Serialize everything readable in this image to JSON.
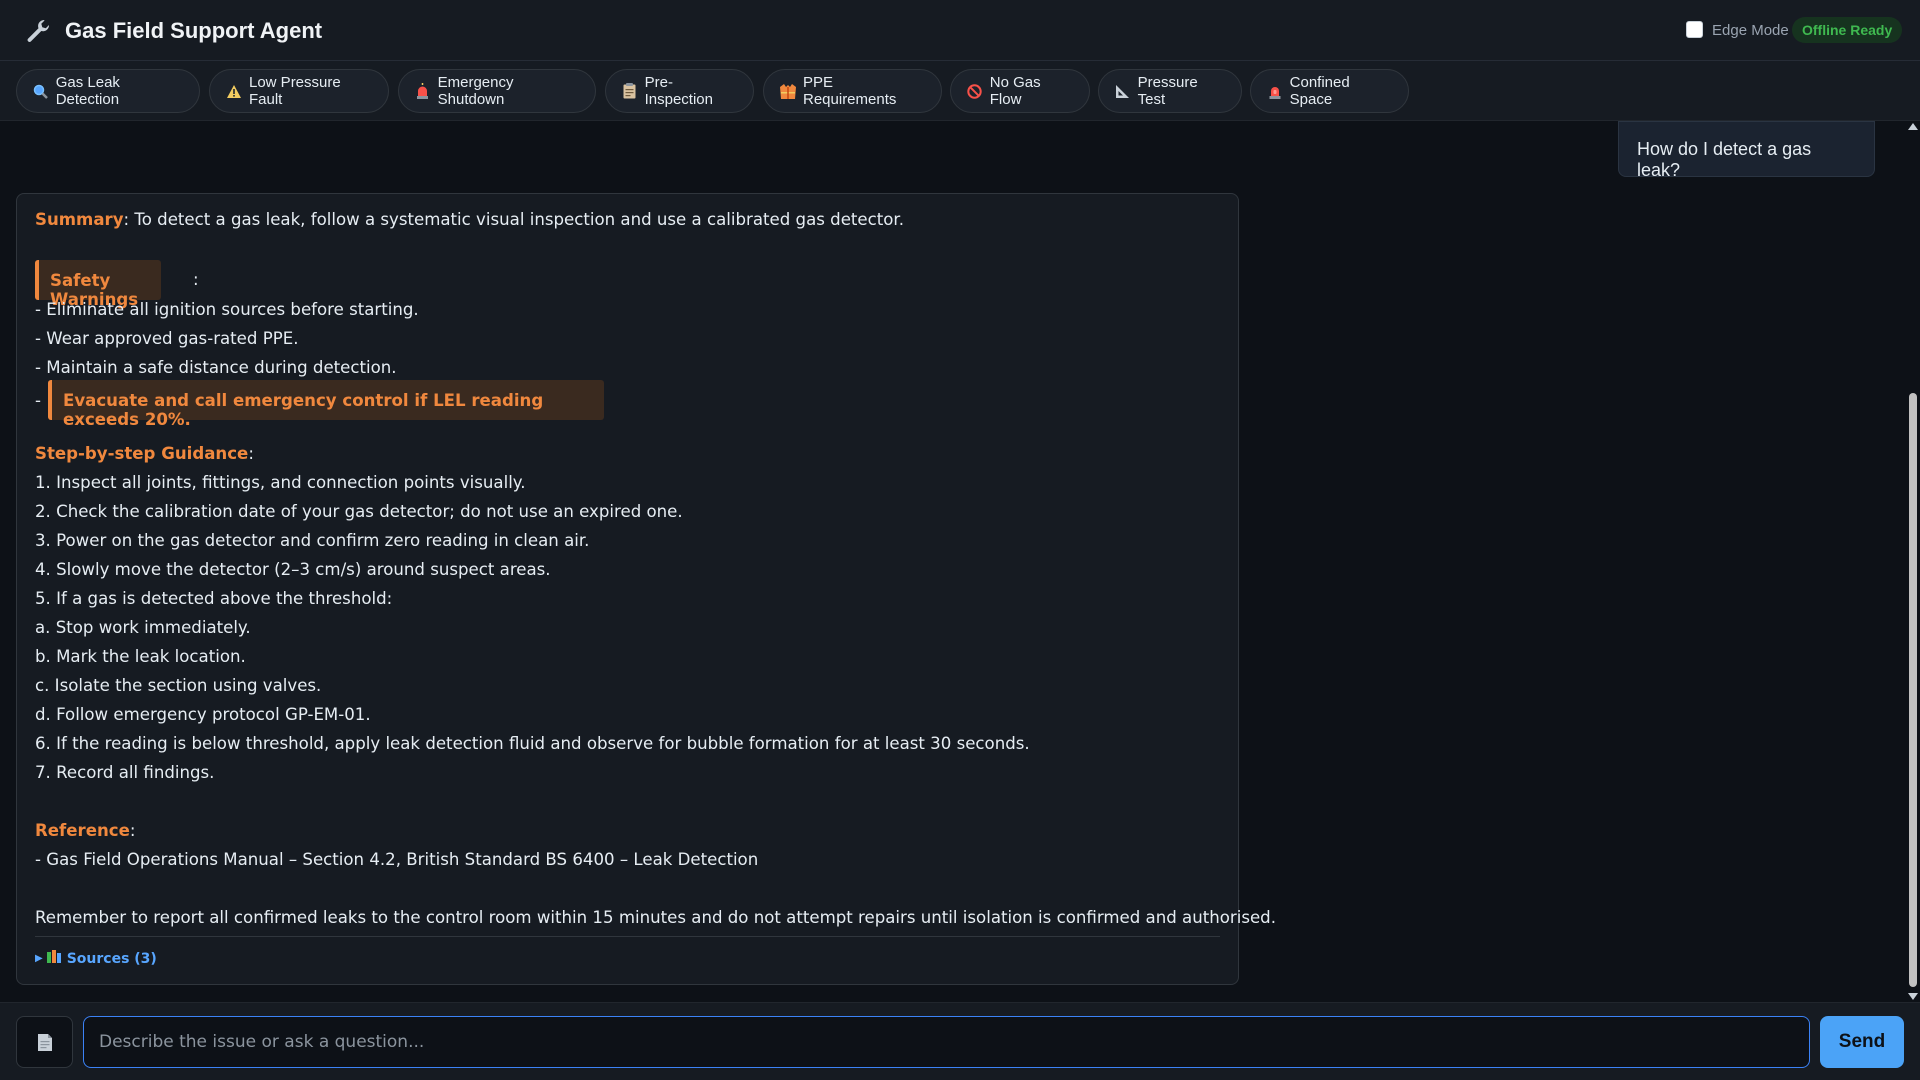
{
  "header": {
    "title": "Gas Field Support Agent",
    "icon": "wrench-icon",
    "edge_mode_label": "Edge Mode",
    "status_badge": "Offline Ready",
    "accent": "#3fb950"
  },
  "quick_actions": [
    {
      "label": "Gas Leak Detection",
      "icon": "magnifier-icon"
    },
    {
      "label": "Low Pressure Fault",
      "icon": "warning-icon"
    },
    {
      "label": "Emergency Shutdown",
      "icon": "siren-icon"
    },
    {
      "label": "Pre-Inspection",
      "icon": "clipboard-icon"
    },
    {
      "label": "PPE Requirements",
      "icon": "safety-vest-icon"
    },
    {
      "label": "No Gas Flow",
      "icon": "no-entry-icon"
    },
    {
      "label": "Pressure Test",
      "icon": "triangle-ruler-icon"
    },
    {
      "label": "Confined Space",
      "icon": "alarm-light-icon"
    }
  ],
  "chat": {
    "user_message": "How do I detect a gas leak?",
    "answer": {
      "summary_heading": "Summary",
      "summary_text": ": To detect a gas leak, follow a systematic visual inspection and use a calibrated gas detector.",
      "warnings_heading": "Safety Warnings",
      "warnings_colon": ":",
      "warnings": [
        "- Eliminate all ignition sources before starting.",
        "- Wear approved gas-rated PPE.",
        "- Maintain a safe distance during detection."
      ],
      "critical_dash": "-",
      "critical_warning": "Evacuate and call emergency control if LEL reading exceeds 20%.",
      "steps_heading": "Step-by-step Guidance",
      "steps_colon": ":",
      "steps": [
        "1. Inspect all joints, fittings, and connection points visually.",
        "2. Check the calibration date of your gas detector; do not use an expired one.",
        "3. Power on the gas detector and confirm zero reading in clean air.",
        "4. Slowly move the detector (2–3 cm/s) around suspect areas.",
        "5. If a gas is detected above the threshold:",
        "a. Stop work immediately.",
        "b. Mark the leak location.",
        "c. Isolate the section using valves.",
        "d. Follow emergency protocol GP-EM-01.",
        "6. If the reading is below threshold, apply leak detection fluid and observe for bubble formation for at least 30 seconds.",
        "7. Record all findings."
      ],
      "reference_heading": "Reference",
      "reference_colon": ":",
      "reference_text": "- Gas Field Operations Manual – Section 4.2, British Standard BS 6400 – Leak Detection",
      "closing": "Remember to report all confirmed leaks to the control room within 15 minutes and do not attempt repairs until isolation is confirmed and authorised.",
      "sources_label": "Sources (3)"
    }
  },
  "composer": {
    "placeholder": "Describe the issue or ask a question...",
    "value": "",
    "send_label": "Send",
    "attach_icon": "document-icon"
  }
}
